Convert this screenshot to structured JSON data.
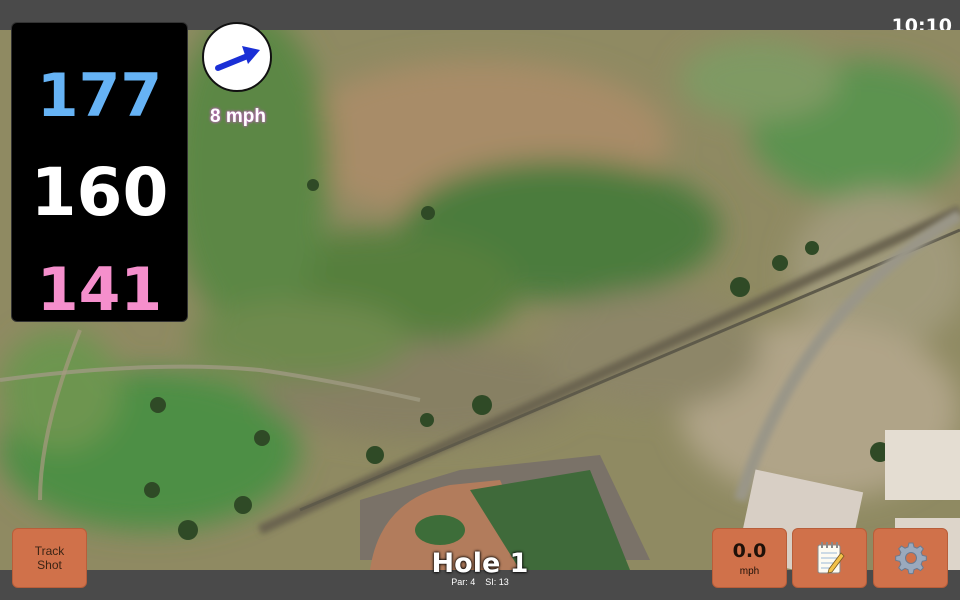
{
  "status_bar": {
    "time": "10:10"
  },
  "distances": {
    "back": "177",
    "center": "160",
    "front": "141"
  },
  "wind": {
    "speed": "8 mph",
    "icon": "arrow-right-up-icon"
  },
  "hole": {
    "title": "Hole 1",
    "par": "Par: 4",
    "si": "SI: 13"
  },
  "buttons": {
    "track_shot_line1": "Track",
    "track_shot_line2": "Shot",
    "speed_value": "0.0",
    "speed_unit": "mph",
    "notes_icon": "notepad-icon",
    "settings_icon": "gear-icon"
  },
  "colors": {
    "back_distance": "#66b3f5",
    "center_distance": "#ffffff",
    "front_distance": "#f58fcc",
    "button_bg": "#d0714a",
    "wind_arrow": "#1a2fd6"
  }
}
